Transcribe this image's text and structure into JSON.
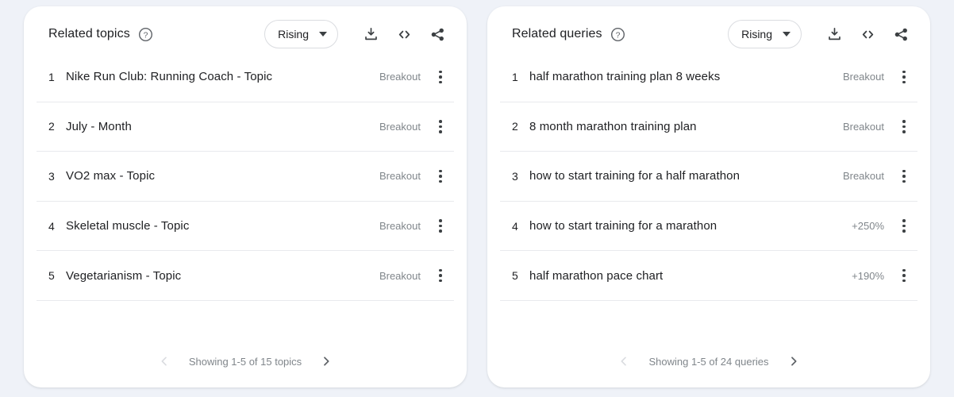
{
  "page": {
    "background_color": "#eff2f8",
    "card_background": "#ffffff",
    "text_color": "#202124",
    "muted_color": "#80868b",
    "divider_color": "#e8eaed"
  },
  "cards": [
    {
      "title": "Related topics",
      "help_icon": "help-circle-icon",
      "sort": {
        "label": "Rising",
        "caret_icon": "chevron-down-icon"
      },
      "actions": [
        {
          "icon": "download-icon"
        },
        {
          "icon": "embed-code-icon"
        },
        {
          "icon": "share-icon"
        }
      ],
      "rows": [
        {
          "rank": "1",
          "label": "Nike Run Club: Running Coach - Topic",
          "value": "Breakout",
          "menu_icon": "more-vert-icon"
        },
        {
          "rank": "2",
          "label": "July - Month",
          "value": "Breakout",
          "menu_icon": "more-vert-icon"
        },
        {
          "rank": "3",
          "label": "VO2 max - Topic",
          "value": "Breakout",
          "menu_icon": "more-vert-icon"
        },
        {
          "rank": "4",
          "label": "Skeletal muscle - Topic",
          "value": "Breakout",
          "menu_icon": "more-vert-icon"
        },
        {
          "rank": "5",
          "label": "Vegetarianism - Topic",
          "value": "Breakout",
          "menu_icon": "more-vert-icon"
        }
      ],
      "footer": {
        "prev_icon": "chevron-left-icon",
        "prev_enabled": false,
        "status": "Showing 1-5 of 15 topics",
        "next_icon": "chevron-right-icon",
        "next_enabled": true
      }
    },
    {
      "title": "Related queries",
      "help_icon": "help-circle-icon",
      "sort": {
        "label": "Rising",
        "caret_icon": "chevron-down-icon"
      },
      "actions": [
        {
          "icon": "download-icon"
        },
        {
          "icon": "embed-code-icon"
        },
        {
          "icon": "share-icon"
        }
      ],
      "rows": [
        {
          "rank": "1",
          "label": "half marathon training plan 8 weeks",
          "value": "Breakout",
          "menu_icon": "more-vert-icon"
        },
        {
          "rank": "2",
          "label": "8 month marathon training plan",
          "value": "Breakout",
          "menu_icon": "more-vert-icon"
        },
        {
          "rank": "3",
          "label": "how to start training for a half marathon",
          "value": "Breakout",
          "menu_icon": "more-vert-icon"
        },
        {
          "rank": "4",
          "label": "how to start training for a marathon",
          "value": "+250%",
          "menu_icon": "more-vert-icon"
        },
        {
          "rank": "5",
          "label": "half marathon pace chart",
          "value": "+190%",
          "menu_icon": "more-vert-icon"
        }
      ],
      "footer": {
        "prev_icon": "chevron-left-icon",
        "prev_enabled": false,
        "status": "Showing 1-5 of 24 queries",
        "next_icon": "chevron-right-icon",
        "next_enabled": true
      }
    }
  ]
}
